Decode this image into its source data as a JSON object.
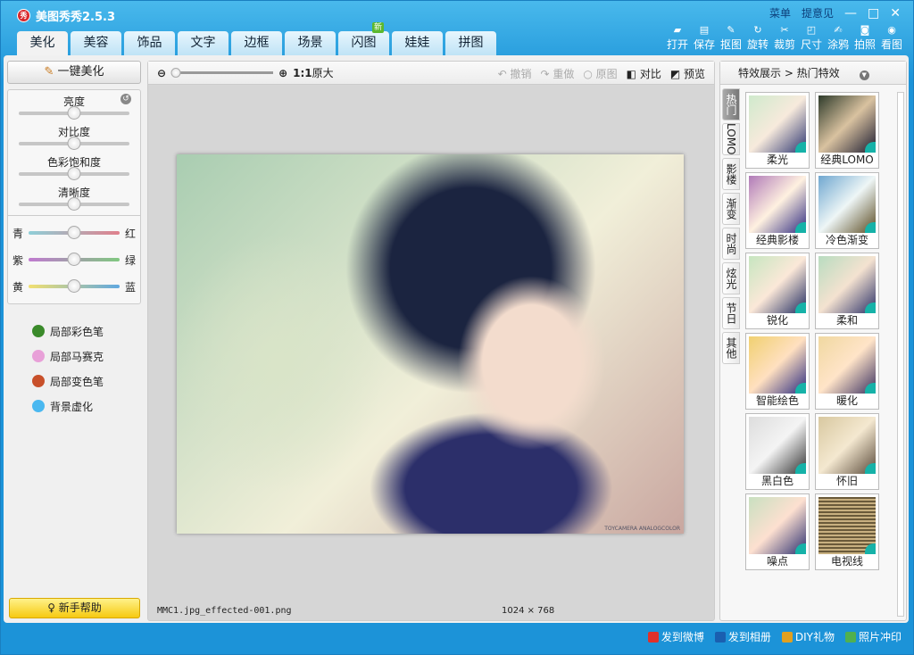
{
  "app": {
    "title": "美图秀秀2.5.3",
    "logo": "秀"
  },
  "topright": {
    "menu": "菜单",
    "feedback": "提意见",
    "minimize": "—",
    "maximize": "□",
    "close": "✕"
  },
  "tabs": [
    {
      "label": "美化"
    },
    {
      "label": "美容"
    },
    {
      "label": "饰品"
    },
    {
      "label": "文字"
    },
    {
      "label": "边框"
    },
    {
      "label": "场景"
    },
    {
      "label": "闪图",
      "badge": "新"
    },
    {
      "label": "娃娃"
    },
    {
      "label": "拼图"
    }
  ],
  "tools": [
    {
      "label": "打开",
      "icon": "▰"
    },
    {
      "label": "保存",
      "icon": "▤"
    },
    {
      "label": "抠图",
      "icon": "✎"
    },
    {
      "label": "旋转",
      "icon": "↻"
    },
    {
      "label": "裁剪",
      "icon": "✂"
    },
    {
      "label": "尺寸",
      "icon": "◰"
    },
    {
      "label": "涂鸦",
      "icon": "✍"
    },
    {
      "label": "拍照",
      "icon": "◙"
    },
    {
      "label": "看图",
      "icon": "◉"
    }
  ],
  "left": {
    "onekey": "一键美化",
    "sliders": [
      {
        "label": "亮度",
        "value": 0.5
      },
      {
        "label": "对比度",
        "value": 0.5
      },
      {
        "label": "色彩饱和度",
        "value": 0.5
      },
      {
        "label": "清晰度",
        "value": 0.5
      }
    ],
    "reset": "↺",
    "color_sliders": [
      {
        "left": "青",
        "right": "红",
        "value": 0.5,
        "gradient": [
          "#8fcfd8",
          "#e0808c"
        ]
      },
      {
        "left": "紫",
        "right": "绿",
        "value": 0.5,
        "gradient": [
          "#c07ad0",
          "#80c880"
        ]
      },
      {
        "left": "黄",
        "right": "蓝",
        "value": 0.5,
        "gradient": [
          "#f2e070",
          "#60a8e0"
        ]
      }
    ],
    "tools": [
      {
        "label": "局部彩色笔",
        "color": "#3a8a2a"
      },
      {
        "label": "局部马赛克",
        "color": "#e8a0d8"
      },
      {
        "label": "局部变色笔",
        "color": "#c8502a"
      },
      {
        "label": "背景虚化",
        "color": "#4ab8f0"
      }
    ],
    "help": "新手帮助"
  },
  "canvas": {
    "zoom_label": "1:1",
    "zoom_text": "原大",
    "undo": "撤销",
    "redo": "重做",
    "original": "原图",
    "compare": "对比",
    "preview": "预览",
    "watermark": "TOYCAMERA ANALOGCOLOR",
    "filename": "MMC1.jpg_effected-001.png",
    "dimensions": "1024 × 768"
  },
  "right": {
    "header": "特效展示 > 热门特效",
    "vtabs": [
      "热门",
      "LOMO",
      "影楼",
      "渐变",
      "时尚",
      "炫光",
      "节日",
      "其他"
    ],
    "effects": [
      {
        "label": "柔光",
        "bg": "linear-gradient(135deg,#cfeacc,#f7eadc 50%,#2b3470)"
      },
      {
        "label": "经典LOMO",
        "bg": "linear-gradient(135deg,#2d3a2a,#d9c2a0 50%,#1b1b30)"
      },
      {
        "label": "经典影楼",
        "bg": "linear-gradient(135deg,#b07ab8,#fff1e0 50%,#2e2a80)"
      },
      {
        "label": "冷色渐变",
        "bg": "linear-gradient(135deg,#6fa7d0,#eef6f6 50%,#5a4a20)"
      },
      {
        "label": "锐化",
        "bg": "linear-gradient(135deg,#c6e6c0,#fbe8d8 50%,#1e2a60)"
      },
      {
        "label": "柔和",
        "bg": "linear-gradient(135deg,#b8dcc0,#f4e2d0 50%,#2a3068)"
      },
      {
        "label": "智能绘色",
        "bg": "linear-gradient(135deg,#f0d070,#ffe0c0 50%,#2a2a80)"
      },
      {
        "label": "暖化",
        "bg": "linear-gradient(135deg,#f0d8a0,#ffe4c8 50%,#3a3060)"
      },
      {
        "label": "黑白色",
        "bg": "linear-gradient(135deg,#ddd,#f4f4f4 50%,#333)"
      },
      {
        "label": "怀旧",
        "bg": "linear-gradient(135deg,#d8c8a0,#f4e8d0 50%,#5a4a3a)"
      },
      {
        "label": "噪点",
        "bg": "linear-gradient(135deg,#c8e0c0,#fde0d0 50%,#2a2e70)"
      },
      {
        "label": "电视线",
        "bg": "repeating-linear-gradient(#6a5a3a 0 2px,#c8b080 2px 4px)"
      }
    ]
  },
  "bottom": [
    {
      "label": "发到微博",
      "color": "#e0302a"
    },
    {
      "label": "发到相册",
      "color": "#1a5fb0"
    },
    {
      "label": "DIY礼物",
      "color": "#e0a020"
    },
    {
      "label": "照片冲印",
      "color": "#50b050"
    }
  ]
}
